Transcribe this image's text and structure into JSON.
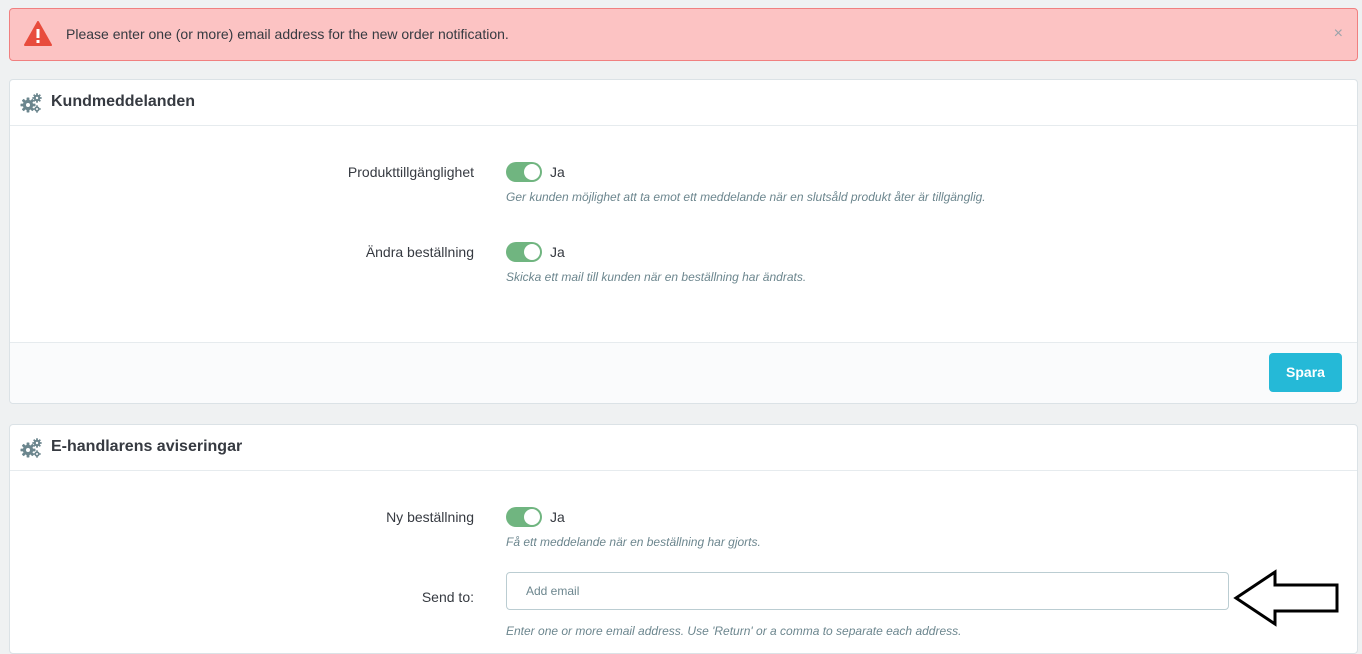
{
  "alert": {
    "message": "Please enter one (or more) email address for the new order notification.",
    "close_label": "×",
    "icon": "warning-triangle-icon",
    "color": "#fcc3c3"
  },
  "customer_panel": {
    "title": "Kundmeddelanden",
    "icon": "cogs-icon",
    "rows": [
      {
        "label": "Produkttillgänglighet",
        "value_label": "Ja",
        "enabled": true,
        "help": "Ger kunden möjlighet att ta emot ett meddelande när en slutsåld produkt åter är tillgänglig."
      },
      {
        "label": "Ändra beställning",
        "value_label": "Ja",
        "enabled": true,
        "help": "Skicka ett mail till kunden när en beställning har ändrats."
      }
    ],
    "save_label": "Spara"
  },
  "merchant_panel": {
    "title": "E-handlarens aviseringar",
    "icon": "cogs-icon",
    "new_order": {
      "label": "Ny beställning",
      "value_label": "Ja",
      "enabled": true,
      "help": "Få ett meddelande när en beställning har gjorts."
    },
    "send_to": {
      "label": "Send to:",
      "placeholder": "Add email",
      "value": "",
      "help": "Enter one or more email address. Use 'Return' or a comma to separate each address."
    }
  },
  "colors": {
    "accent": "#25b9d7",
    "switch_on": "#70b580",
    "alert_icon": "#e84c3d"
  }
}
